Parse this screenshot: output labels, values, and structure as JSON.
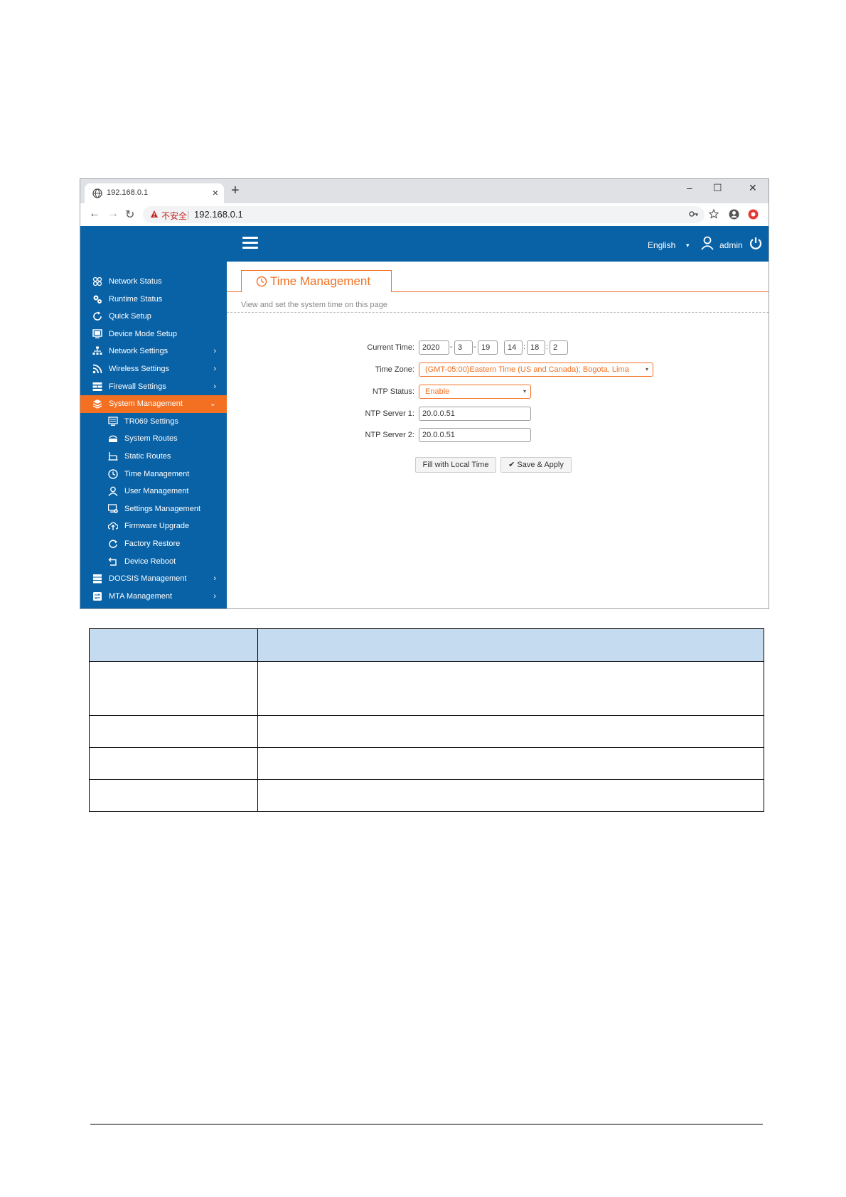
{
  "browser": {
    "tab_title": "192.168.0.1",
    "new_tab": "+",
    "tab_close": "×",
    "minimize": "–",
    "maximize": "☐",
    "close": "✕",
    "security_warning": "不安全",
    "separator": "|",
    "url": "192.168.0.1"
  },
  "header": {
    "language": "English",
    "language_caret": "▾",
    "user": "admin"
  },
  "sidebar": {
    "items": [
      {
        "label": "Network Status",
        "icon": "network-status-icon"
      },
      {
        "label": "Runtime Status",
        "icon": "gears-icon"
      },
      {
        "label": "Quick Setup",
        "icon": "refresh-circle-icon"
      },
      {
        "label": "Device Mode Setup",
        "icon": "monitor-icon"
      },
      {
        "label": "Network Settings",
        "icon": "sitemap-icon",
        "arrow": "›"
      },
      {
        "label": "Wireless Settings",
        "icon": "rss-icon",
        "arrow": "›"
      },
      {
        "label": "Firewall Settings",
        "icon": "firewall-icon",
        "arrow": "›"
      },
      {
        "label": "System Management",
        "icon": "layers-icon",
        "arrow": "⌄",
        "active": true
      },
      {
        "label": "TR069 Settings",
        "icon": "tr069-icon",
        "sub": true
      },
      {
        "label": "System Routes",
        "icon": "router-icon",
        "sub": true
      },
      {
        "label": "Static Routes",
        "icon": "routes-icon",
        "sub": true
      },
      {
        "label": "Time Management",
        "icon": "clock-icon",
        "sub": true
      },
      {
        "label": "User Management",
        "icon": "user-icon",
        "sub": true
      },
      {
        "label": "Settings Management",
        "icon": "settings-monitor-icon",
        "sub": true
      },
      {
        "label": "Firmware Upgrade",
        "icon": "cloud-upload-icon",
        "sub": true
      },
      {
        "label": "Factory Restore",
        "icon": "restore-icon",
        "sub": true
      },
      {
        "label": "Device Reboot",
        "icon": "reboot-icon",
        "sub": true
      },
      {
        "label": "DOCSIS Management",
        "icon": "docsis-icon",
        "arrow": "›"
      },
      {
        "label": "MTA Management",
        "icon": "mta-icon",
        "arrow": "›"
      }
    ]
  },
  "content": {
    "title": "Time Management",
    "description": "View and set the system time on this page",
    "form": {
      "current_time_label": "Current Time:",
      "year": "2020",
      "month": "3",
      "day": "19",
      "hour": "14",
      "minute": "18",
      "second": "2",
      "date_sep": "-",
      "time_sep": ":",
      "time_zone_label": "Time Zone:",
      "time_zone_value": "(GMT-05:00)Eastern Time (US and Canada); Bogota, Lima",
      "ntp_status_label": "NTP Status:",
      "ntp_status_value": "Enable",
      "ntp_server1_label": "NTP Server 1:",
      "ntp_server1_value": "20.0.0.51",
      "ntp_server2_label": "NTP Server 2:",
      "ntp_server2_value": "20.0.0.51",
      "caret": "▾",
      "fill_button": "Fill with Local Time",
      "save_button": "✔ Save & Apply"
    }
  },
  "colors": {
    "brand_blue": "#0a62a6",
    "accent_orange": "#f36f21",
    "table_header": "#c5dcf0"
  }
}
